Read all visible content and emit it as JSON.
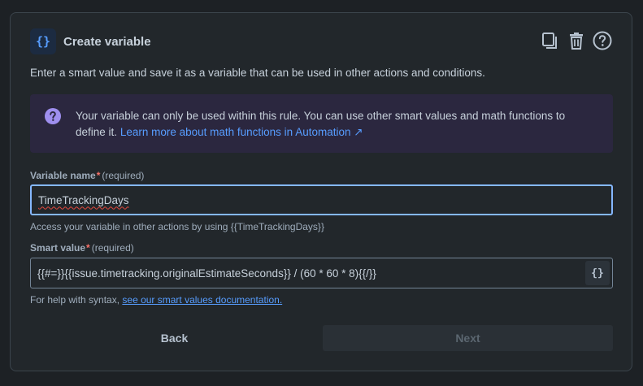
{
  "header": {
    "title_icon": "{}",
    "title": "Create variable",
    "icons": [
      "copy-icon",
      "trash-icon",
      "help-icon"
    ]
  },
  "description": "Enter a smart value and save it as a variable that can be used in other actions and conditions.",
  "info": {
    "icon": "question-circle-icon",
    "text": "Your variable can only be used within this rule. You can use other smart values and math functions to define it.",
    "link_text": "Learn more about math functions in Automation ↗"
  },
  "variable_name": {
    "label": "Variable name",
    "required_marker": "*",
    "required_text": "(required)",
    "value": "TimeTrackingDays",
    "helper": "Access your variable in other actions by using {{TimeTrackingDays}}"
  },
  "smart_value": {
    "label": "Smart value",
    "required_marker": "*",
    "required_text": "(required)",
    "value": "{{#=}}{{issue.timetracking.originalEstimateSeconds}} / (60 * 60 * 8){{/}}",
    "braces_button": "{}",
    "helper_prefix": "For help with syntax,",
    "helper_link": "see our smart values documentation."
  },
  "buttons": {
    "back": "Back",
    "next": "Next"
  },
  "colors": {
    "accent": "#579dff",
    "info_bg": "#2b273f",
    "info_icon": "#9f8fef",
    "required": "#f87168"
  }
}
